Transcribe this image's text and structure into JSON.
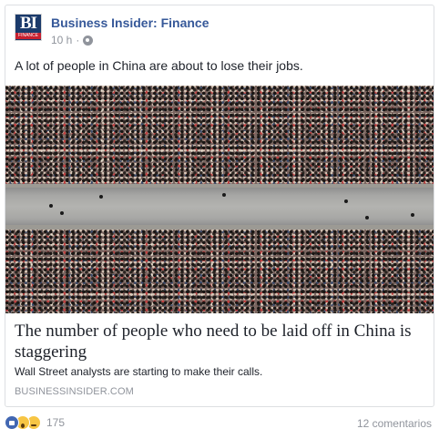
{
  "header": {
    "page_name": "Business Insider: Finance",
    "avatar_text": "BI",
    "avatar_subtext": "FINANCE",
    "time": "10 h",
    "separator": "·",
    "privacy_icon": "globe-icon"
  },
  "post": {
    "caption": "A lot of people in China are about to lose their jobs.",
    "image_icon": "crowd-photo"
  },
  "link": {
    "title": "The number of people who need to be laid off in China is staggering",
    "description": "Wall Street analysts are starting to make their calls.",
    "domain": "BUSINESSINSIDER.COM"
  },
  "footer": {
    "reaction_icons": [
      "like-icon",
      "wow-icon",
      "sad-icon"
    ],
    "reaction_count": "175",
    "comments": "12 comentarios"
  },
  "colors": {
    "page_name": "#365899",
    "meta": "#90949c",
    "like": "#4267b2",
    "border": "#dddfe2"
  }
}
